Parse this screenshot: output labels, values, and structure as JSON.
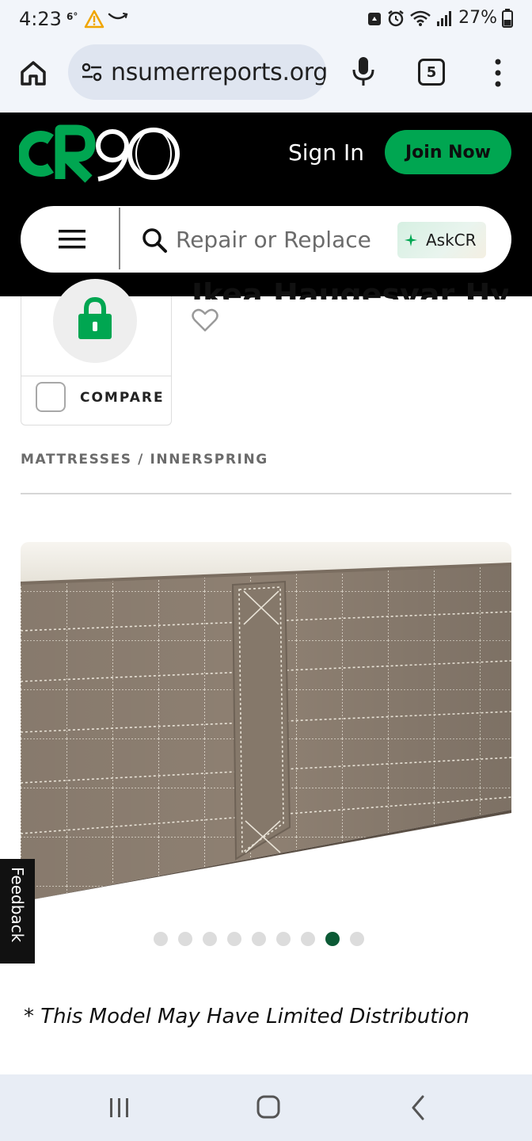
{
  "status_bar": {
    "time": "4:23",
    "temperature": "6°",
    "battery_percent": "27%",
    "icons": [
      "warning-icon",
      "amazon-icon",
      "recycle-icon",
      "alarm-icon",
      "wifi-icon",
      "signal-icon",
      "battery-icon"
    ]
  },
  "browser": {
    "url_display": "nsumerreports.org",
    "tab_count": "5"
  },
  "header": {
    "logo_text": "CR90",
    "sign_in": "Sign In",
    "join_now": "Join Now",
    "search_placeholder": "Repair or Replace",
    "askcr": "AskCR"
  },
  "product": {
    "partial_title": "Ikea Haugesvar Hybrid",
    "compare_label": "COMPARE",
    "breadcrumb": "MATTRESSES / INNERSPRING",
    "image_count": 9,
    "active_image_index": 8,
    "distribution_note": "* This Model May Have Limited Distribution"
  },
  "feedback": {
    "label": "Feedback"
  },
  "colors": {
    "brand_green": "#00a651",
    "header_black": "#000000",
    "active_dot": "#0b5a35",
    "fabric_taupe": "#8d7e6f"
  }
}
